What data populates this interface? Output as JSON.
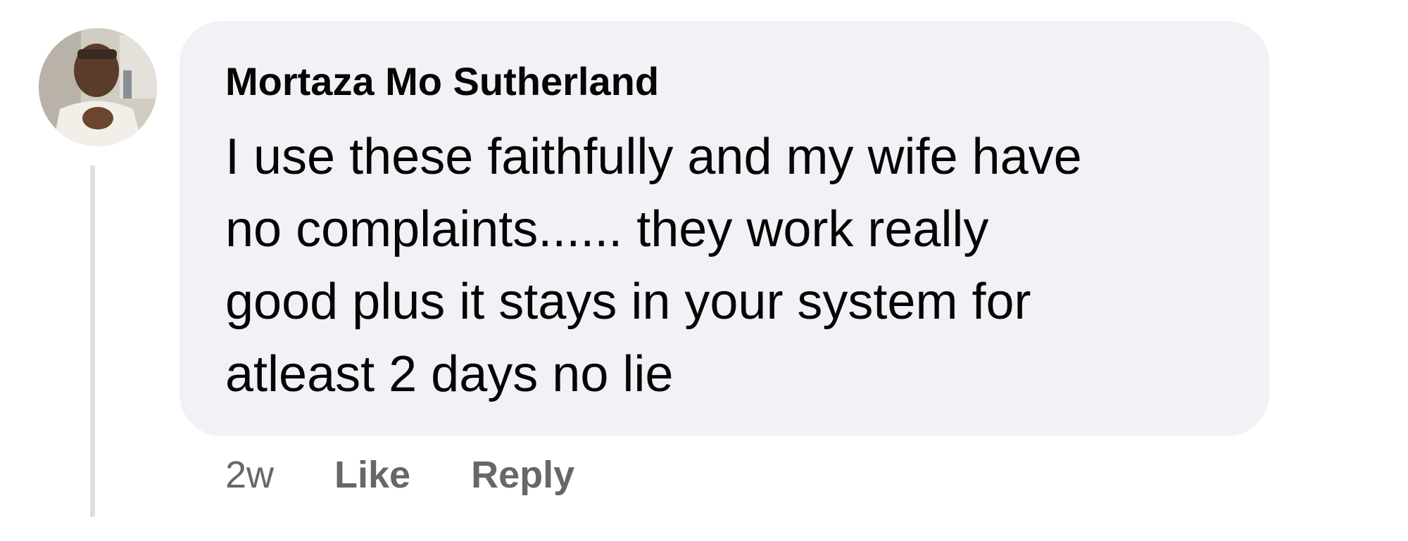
{
  "comment": {
    "author": "Mortaza Mo Sutherland",
    "text": "I use these faithfully and my wife have no complaints...... they work really good plus it stays in your system for atleast 2 days no lie",
    "lines": [
      "I use these faithfully and my wife have",
      "no complaints...... they work really",
      "good plus it stays in your system for",
      "atleast 2 days no lie"
    ],
    "timestamp": "2w",
    "actions": {
      "like_label": "Like",
      "reply_label": "Reply"
    }
  },
  "colors": {
    "bubble_background": "#f0f2f5",
    "text_primary": "#050505",
    "text_secondary": "#65676b",
    "thread_line": "#dcdfe4"
  },
  "icons": {
    "avatar": "profile-photo"
  }
}
